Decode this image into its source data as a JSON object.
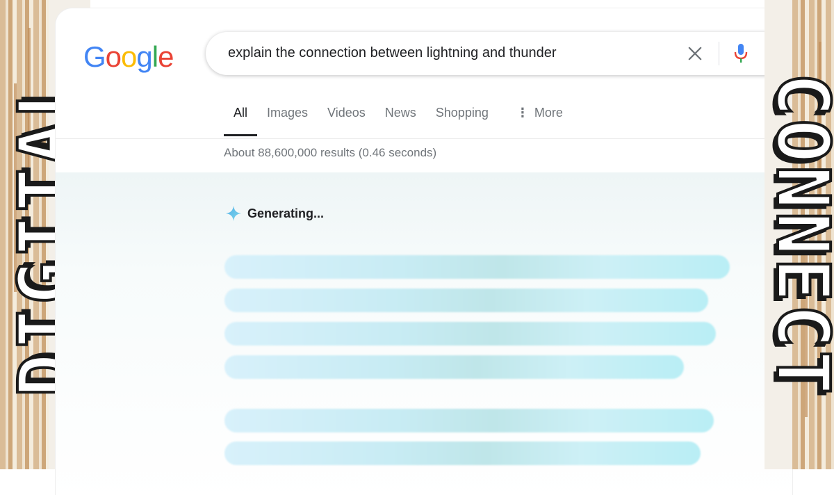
{
  "decor": {
    "left_word": "DIGITAL",
    "right_word": "CONNECT"
  },
  "logo": {
    "letters": [
      "G",
      "o",
      "o",
      "g",
      "l",
      "e"
    ],
    "colors": [
      "#4285F4",
      "#EA4335",
      "#FBBC05",
      "#4285F4",
      "#34A853",
      "#EA4335"
    ]
  },
  "search": {
    "query": "explain the connection between lightning and thunder",
    "icons": [
      "close-icon",
      "mic-icon",
      "lens-icon"
    ]
  },
  "tabs": [
    {
      "label": "All",
      "active": true
    },
    {
      "label": "Images",
      "active": false
    },
    {
      "label": "Videos",
      "active": false
    },
    {
      "label": "News",
      "active": false
    },
    {
      "label": "Shopping",
      "active": false
    },
    {
      "label": "More",
      "active": false
    }
  ],
  "result_stats": "About 88,600,000 results (0.46 seconds)",
  "ai_overview": {
    "status": "Generating..."
  },
  "colors": {
    "accent_blue": "#4285F4",
    "text_primary": "#202124",
    "text_secondary": "#70757a",
    "skeleton": "#c8ecf4"
  }
}
